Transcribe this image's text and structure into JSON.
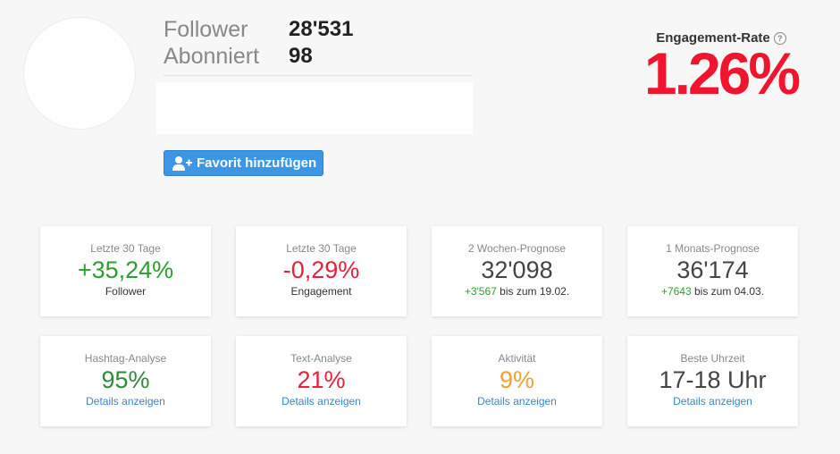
{
  "profile": {
    "follower_label": "Follower",
    "follower_value": "28'531",
    "following_label": "Abonniert",
    "following_value": "98"
  },
  "favorite_button": {
    "label": "Favorit hinzufügen",
    "icon": "user-plus-icon"
  },
  "engagement": {
    "label": "Engagement-Rate",
    "help_glyph": "?",
    "value": "1.26%",
    "color": "#f0142c"
  },
  "cards_row1": [
    {
      "label": "Letzte 30 Tage",
      "value": "+35,24%",
      "sub": "Follower",
      "value_color": "#2ca02c"
    },
    {
      "label": "Letzte 30 Tage",
      "value": "-0,29%",
      "sub": "Engagement",
      "value_color": "#e8203a"
    },
    {
      "label": "2 Wochen-Prognose",
      "value": "32'098",
      "sub_delta": "+3'567",
      "sub_rest": " bis zum 19.02."
    },
    {
      "label": "1 Monats-Prognose",
      "value": "36'174",
      "sub_delta": "+7643",
      "sub_rest": " bis zum 04.03."
    }
  ],
  "cards_row2": [
    {
      "label": "Hashtag-Analyse",
      "value": "95%",
      "link": "Details anzeigen",
      "value_color": "#2e8b3a"
    },
    {
      "label": "Text-Analyse",
      "value": "21%",
      "link": "Details anzeigen",
      "value_color": "#e8203a"
    },
    {
      "label": "Aktivität",
      "value": "9%",
      "link": "Details anzeigen",
      "value_color": "#f0a030"
    },
    {
      "label": "Beste Uhrzeit",
      "value": "17-18 Uhr",
      "link": "Details anzeigen"
    }
  ],
  "colors": {
    "accent_blue": "#3d95e6",
    "link_blue": "#3d85c6",
    "positive_green": "#2ca02c",
    "negative_red": "#e8203a",
    "warning_orange": "#f0a030"
  }
}
